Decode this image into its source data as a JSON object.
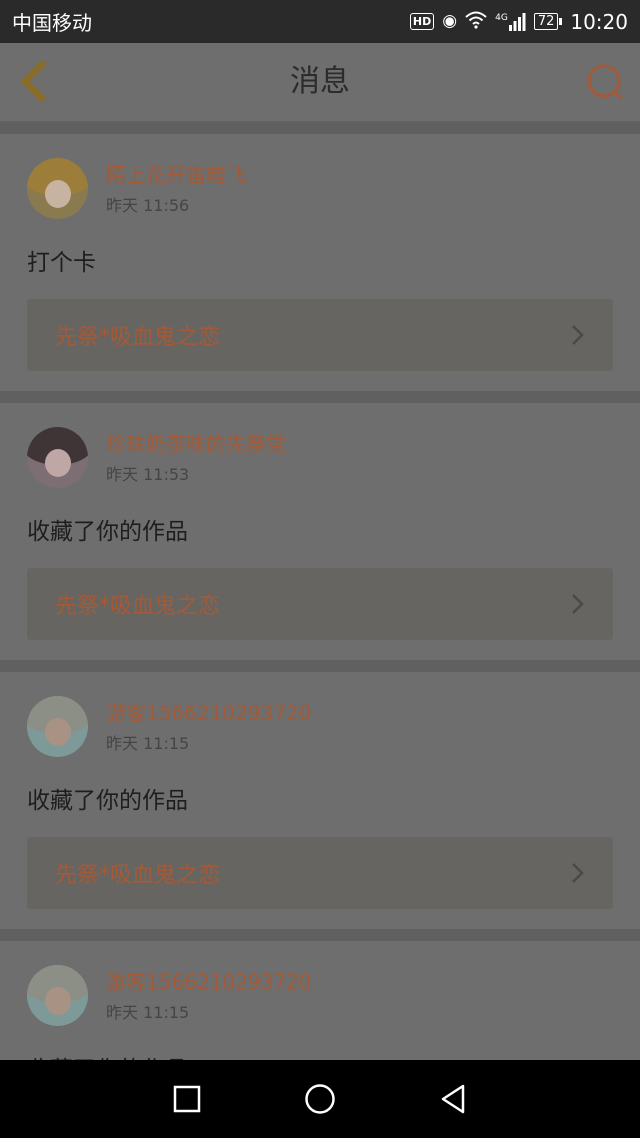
{
  "status_bar": {
    "carrier": "中国移动",
    "hd": "HD",
    "network": "4G",
    "battery": "72",
    "time": "10:20"
  },
  "header": {
    "title": "消息"
  },
  "messages": [
    {
      "username": "陌上花开笛暗飞",
      "time": "昨天 11:56",
      "content": "打个卡",
      "work_title": "先祭*吸血鬼之恋"
    },
    {
      "username": "珍珠奶茶味的先祭党",
      "time": "昨天 11:53",
      "content": "收藏了你的作品",
      "work_title": "先祭*吸血鬼之恋"
    },
    {
      "username": "游客1566210293720",
      "time": "昨天 11:15",
      "content": "收藏了你的作品",
      "work_title": "先祭*吸血鬼之恋"
    },
    {
      "username": "游客1566210293720",
      "time": "昨天 11:15",
      "content": "收藏了你的作品",
      "work_title": ""
    }
  ],
  "colors": {
    "accent": "#a45a36",
    "icon": "#8b6c22"
  }
}
